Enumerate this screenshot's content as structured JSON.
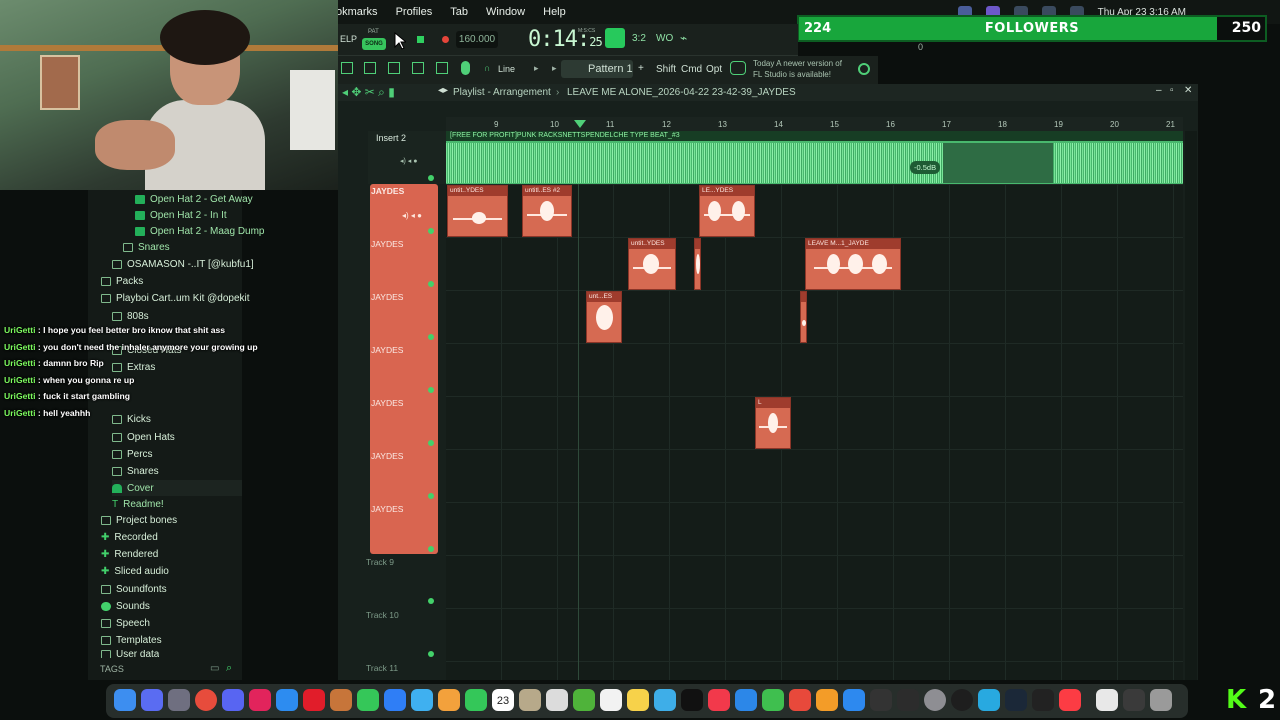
{
  "menubar": {
    "menus": [
      "okmarks",
      "Profiles",
      "Tab",
      "Window",
      "Help"
    ],
    "datetime": "Thu Apr 23  3:16 AM"
  },
  "followers": {
    "current": "224",
    "label": "FOLLOWERS",
    "goal": "250",
    "progress_fraction": 0.896
  },
  "toolbar": {
    "help_fragment": "ELP",
    "pat_label": "PAT",
    "song_label": "SONG",
    "bpm": "160.000",
    "time_main": "0:14:",
    "time_sub": "25",
    "time_caption": "M:S:CS",
    "pattern": "Pattern 1",
    "snap": "Line",
    "shift": "Shift",
    "cmd": "Cmd",
    "opt": "Opt",
    "update_line1": "Today  A newer version of",
    "update_line2": "FL Studio is available!",
    "cpu_fragment": "0"
  },
  "playlist": {
    "title": "Playlist - Arrangement",
    "project": "LEAVE ME ALONE_2026-04-22 23-42-39_JAYDES",
    "ruler": [
      "9",
      "10",
      "11",
      "12",
      "13",
      "14",
      "15",
      "16",
      "17",
      "18",
      "19",
      "20",
      "21"
    ],
    "insert_label": "Insert 2",
    "audio_clip_title": "[FREE FOR PROFIT]PUNK RACKSNETTSPENDELCHE TYPE BEAT_#3",
    "audio_db": "-0.5dB",
    "jaydes_tracks": [
      "JAYDES",
      "JAYDES",
      "JAYDES",
      "JAYDES",
      "JAYDES",
      "JAYDES",
      "JAYDES"
    ],
    "empty_tracks": [
      "Track 9",
      "Track 10",
      "Track 11"
    ],
    "clips": [
      {
        "label": "untit..YDES"
      },
      {
        "label": "untitl..ES #2"
      },
      {
        "label": "LE...YDES"
      },
      {
        "label": "untit..YDES"
      },
      {
        "label": ""
      },
      {
        "label": "LEAVE M...1_JAYDE"
      },
      {
        "label": "unt...ES"
      },
      {
        "label": ""
      },
      {
        "label": "L"
      }
    ]
  },
  "browser": {
    "items": [
      {
        "label": "Open Hat 2 - Get Away",
        "icon": "green"
      },
      {
        "label": "Open Hat 2 - In It",
        "icon": "green"
      },
      {
        "label": "Open Hat 2 - Maag Dump",
        "icon": "green"
      },
      {
        "label": "Snares",
        "icon": "folder"
      },
      {
        "label": "OSAMASON -..IT [@kubfu1]",
        "icon": "folder"
      },
      {
        "label": "Packs",
        "icon": "folder"
      },
      {
        "label": "Playboi Cart..um Kit @dopekit",
        "icon": "folder"
      },
      {
        "label": "808s",
        "icon": "folder"
      },
      {
        "label": "",
        "icon": "folder"
      },
      {
        "label": "Closed Hats",
        "icon": "folder"
      },
      {
        "label": "Extras",
        "icon": "folder"
      },
      {
        "label": "",
        "icon": "folder"
      },
      {
        "label": "Kicks",
        "icon": "folder"
      },
      {
        "label": "Open Hats",
        "icon": "folder"
      },
      {
        "label": "Percs",
        "icon": "folder"
      },
      {
        "label": "Snares",
        "icon": "folder"
      },
      {
        "label": "Cover",
        "icon": "plant"
      },
      {
        "label": "Readme!",
        "icon": "text"
      },
      {
        "label": "Project bones",
        "icon": "folder"
      },
      {
        "label": "Recorded",
        "icon": "plus"
      },
      {
        "label": "Rendered",
        "icon": "plus"
      },
      {
        "label": "Sliced audio",
        "icon": "plus"
      },
      {
        "label": "Soundfonts",
        "icon": "folder"
      },
      {
        "label": "Sounds",
        "icon": "cloud"
      },
      {
        "label": "Speech",
        "icon": "folder"
      },
      {
        "label": "Templates",
        "icon": "folder"
      },
      {
        "label": "User data",
        "icon": "folder"
      }
    ],
    "tags_label": "TAGS"
  },
  "chat": [
    {
      "user": "UriGetti",
      "text": ": I hope you feel better bro iknow that shit ass"
    },
    {
      "user": "UriGetti",
      "text": ": you don't need the inhaler anymore your growing up"
    },
    {
      "user": "UriGetti",
      "text": ": damnn bro Rip"
    },
    {
      "user": "UriGetti",
      "text": ": when you gonna re up"
    },
    {
      "user": "UriGetti",
      "text": ": fuck it start gambling"
    },
    {
      "user": "UriGetti",
      "text": ": hell yeahhh"
    }
  ],
  "dock": {
    "calendar_day": "23"
  },
  "kick": {
    "logo": "K",
    "number": "2"
  },
  "colors": {
    "accent_green": "#27c95c",
    "clip_red": "#d66a52",
    "followers_bar": "#18a63c",
    "chat_user": "#7dfc5f"
  }
}
